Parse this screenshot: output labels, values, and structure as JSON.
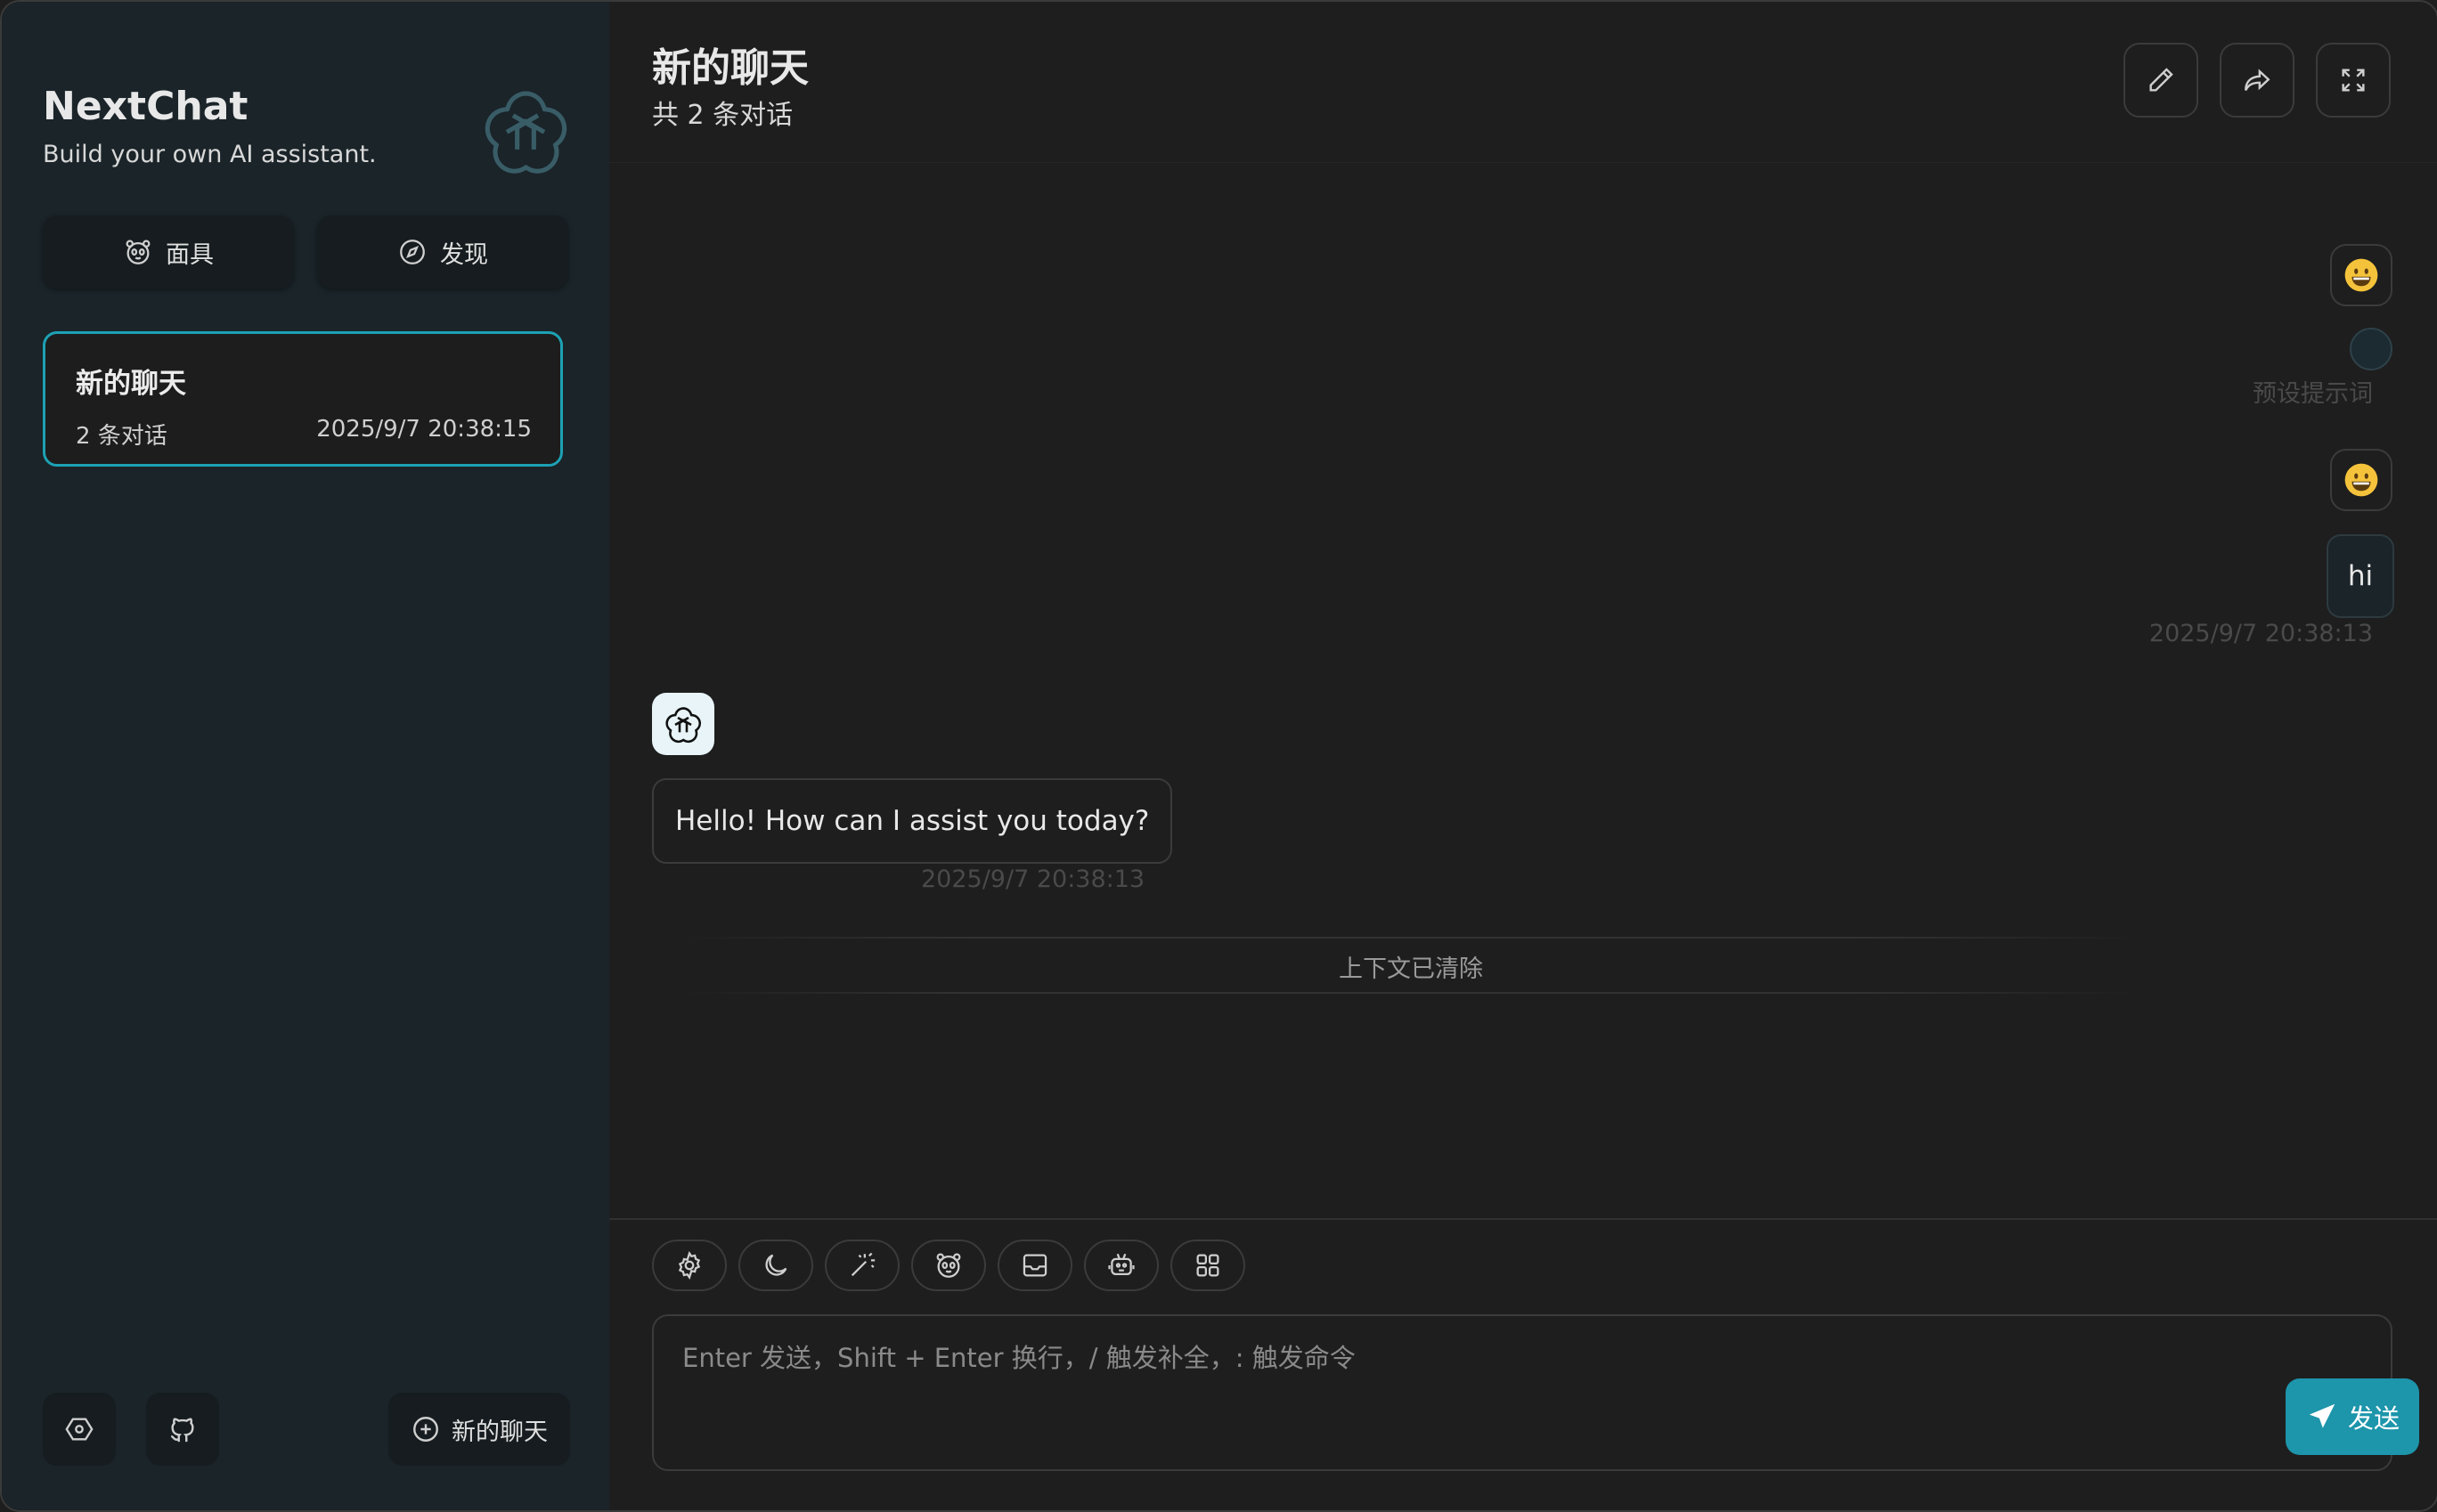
{
  "sidebar": {
    "brand_title": "NextChat",
    "brand_subtitle": "Build your own AI assistant.",
    "mask_button": "面具",
    "discover_button": "发现",
    "chat_list": [
      {
        "title": "新的聊天",
        "count": "2 条对话",
        "time": "2025/9/7 20:38:15"
      }
    ],
    "new_chat_button": "新的聊天"
  },
  "header": {
    "title": "新的聊天",
    "subtitle": "共 2 条对话"
  },
  "messages": {
    "preset_label": "预设提示词",
    "user_text": "hi",
    "user_time": "2025/9/7 20:38:13",
    "bot_text": "Hello! How can I assist you today?",
    "bot_time": "2025/9/7 20:38:13",
    "context_cleared": "上下文已清除"
  },
  "input": {
    "placeholder": "Enter 发送，Shift + Enter 换行，/ 触发补全，: 触发命令",
    "value": "",
    "send_label": "发送"
  },
  "colors": {
    "accent": "#1d95ab",
    "sidebar_bg": "#1a2429",
    "main_bg": "#1e1e1e"
  }
}
